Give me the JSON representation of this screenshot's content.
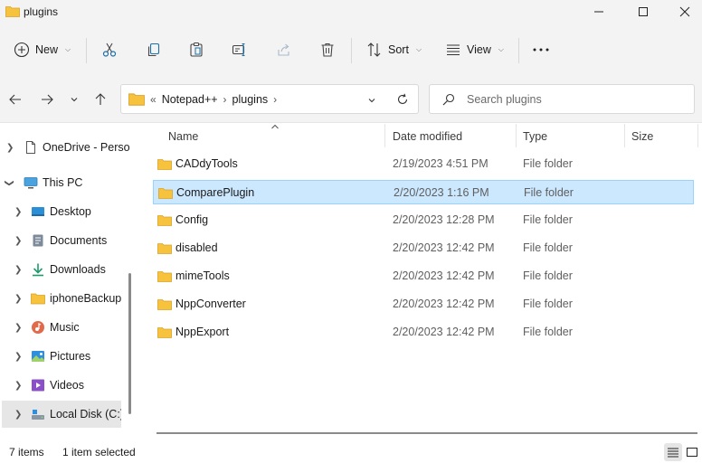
{
  "window": {
    "title": "plugins"
  },
  "toolbar": {
    "new_label": "New",
    "sort_label": "Sort",
    "view_label": "View"
  },
  "address": {
    "overflow": "«",
    "crumbs": [
      "Notepad++",
      "plugins"
    ]
  },
  "search": {
    "placeholder": "Search plugins"
  },
  "nav": {
    "items": [
      {
        "label": "OneDrive - Perso",
        "icon": "document-icon"
      },
      {
        "label": "This PC",
        "icon": "computer-icon"
      },
      {
        "label": "Desktop",
        "icon": "desktop-icon"
      },
      {
        "label": "Documents",
        "icon": "documents-icon"
      },
      {
        "label": "Downloads",
        "icon": "download-icon"
      },
      {
        "label": "iphoneBackup",
        "icon": "folder-icon"
      },
      {
        "label": "Music",
        "icon": "music-icon"
      },
      {
        "label": "Pictures",
        "icon": "pictures-icon"
      },
      {
        "label": "Videos",
        "icon": "videos-icon"
      },
      {
        "label": "Local Disk (C:)",
        "icon": "drive-icon"
      }
    ]
  },
  "columns": {
    "name": "Name",
    "date": "Date modified",
    "type": "Type",
    "size": "Size"
  },
  "files": [
    {
      "name": "CADdyTools",
      "date": "2/19/2023 4:51 PM",
      "type": "File folder"
    },
    {
      "name": "ComparePlugin",
      "date": "2/20/2023 1:16 PM",
      "type": "File folder"
    },
    {
      "name": "Config",
      "date": "2/20/2023 12:28 PM",
      "type": "File folder"
    },
    {
      "name": "disabled",
      "date": "2/20/2023 12:42 PM",
      "type": "File folder"
    },
    {
      "name": "mimeTools",
      "date": "2/20/2023 12:42 PM",
      "type": "File folder"
    },
    {
      "name": "NppConverter",
      "date": "2/20/2023 12:42 PM",
      "type": "File folder"
    },
    {
      "name": "NppExport",
      "date": "2/20/2023 12:42 PM",
      "type": "File folder"
    }
  ],
  "status": {
    "count": "7 items",
    "selection": "1 item selected"
  },
  "colors": {
    "selection_bg": "#cce8ff",
    "selection_border": "#99d1ff",
    "folder": "#f8c33c",
    "chrome": "#f3f3f3"
  }
}
